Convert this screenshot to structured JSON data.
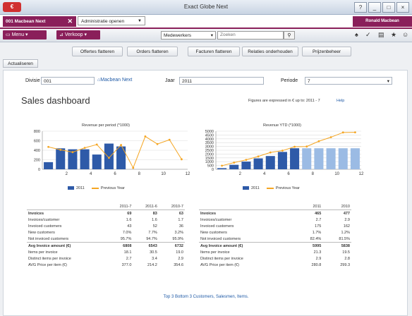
{
  "window": {
    "title": "Exact Globe Next",
    "app_button": "€",
    "controls": [
      "?",
      "_",
      "□",
      "×"
    ]
  },
  "tabs": {
    "active": "001 Macbean Next",
    "close": "✕",
    "second": "Administratie openen",
    "user": "Ronald Macbean"
  },
  "menubar": {
    "menu": "Menu",
    "sales": "Verkoop",
    "category": "Medewerkers",
    "search_placeholder": "Zoeken",
    "search_btn": "⚲",
    "icons": [
      "pin-icon",
      "check-icon",
      "document-icon",
      "star-icon",
      "people-icon"
    ]
  },
  "toolbar": {
    "buttons": [
      "Offertes flatteren",
      "Orders flatteren",
      "Facturen flatteren",
      "Relaties onderhouden",
      "Prijzenbeheer"
    ],
    "refresh": "Actualiseren"
  },
  "filters": {
    "division_label": "Divisie",
    "division_value": "001",
    "division_link": "Macbean Next",
    "year_label": "Jaar",
    "year_value": "2011",
    "period_label": "Periode",
    "period_value": "7"
  },
  "dashboard": {
    "title": "Sales dashboard",
    "note": "Figures are expressed in € up to: 2011 - 7",
    "help": "Help",
    "footer": "Top 3 Bottom 3 Customers, Salesmen, Items."
  },
  "colors": {
    "accent": "#8a1f5a",
    "bar_2011": "#2e5aa8",
    "bar_projected": "#9bbbe4",
    "line_prev": "#f5a623"
  },
  "chart_data": [
    {
      "type": "bar",
      "title": "Revenue per period (*1000)",
      "x": [
        1,
        2,
        3,
        4,
        5,
        6,
        7,
        8,
        9,
        10,
        11,
        12
      ],
      "xticks": [
        2,
        4,
        6,
        8,
        10,
        12
      ],
      "ylim": [
        0,
        800
      ],
      "yticks": [
        0,
        200,
        400,
        600,
        800
      ],
      "series": [
        {
          "name": "2011",
          "kind": "bar",
          "values": [
            150,
            440,
            420,
            420,
            310,
            540,
            480,
            null,
            null,
            null,
            null,
            null
          ]
        },
        {
          "name": "Previous Year",
          "kind": "line",
          "values": [
            470,
            410,
            360,
            450,
            520,
            240,
            510,
            30,
            690,
            530,
            620,
            210
          ]
        }
      ],
      "legend": "bottom"
    },
    {
      "type": "bar",
      "title": "Revenue YTD (*1000)",
      "x": [
        1,
        2,
        3,
        4,
        5,
        6,
        7,
        8,
        9,
        10,
        11,
        12
      ],
      "xticks": [
        2,
        4,
        6,
        8,
        10,
        12
      ],
      "ylim": [
        0,
        5000
      ],
      "yticks": [
        0,
        500,
        1000,
        1500,
        2000,
        2500,
        3000,
        3500,
        4000,
        4500,
        5000
      ],
      "series": [
        {
          "name": "2011",
          "kind": "bar",
          "values": [
            150,
            590,
            1010,
            1430,
            1740,
            2280,
            2760,
            2760,
            2760,
            2760,
            2760,
            2760
          ]
        },
        {
          "name": "Previous Year",
          "kind": "line",
          "values": [
            470,
            880,
            1240,
            1690,
            2210,
            2450,
            2960,
            2990,
            3680,
            4210,
            4830,
            4850
          ]
        }
      ],
      "legend": "bottom"
    }
  ],
  "table_left": {
    "headers": [
      "2011-7",
      "2011-6",
      "2010-7"
    ],
    "rows": [
      {
        "label": "Invoices",
        "bold": true,
        "values": [
          "69",
          "83",
          "63"
        ]
      },
      {
        "label": "Invoices/customer",
        "values": [
          "1.6",
          "1.6",
          "1.7"
        ]
      },
      {
        "label": "Invoiced customers",
        "values": [
          "43",
          "52",
          "36"
        ]
      },
      {
        "label": "New customers",
        "values": [
          "7.0%",
          "7.7%",
          "3.2%"
        ]
      },
      {
        "label": "Not invoiced customers",
        "values": [
          "95.7%",
          "94.7%",
          "95.9%"
        ]
      },
      {
        "label": "Avg Invoice amount (€)",
        "bold": true,
        "section": true,
        "values": [
          "6808",
          "6543",
          "6732"
        ]
      },
      {
        "label": "Items per invoice",
        "values": [
          "18.1",
          "30.5",
          "19.0"
        ]
      },
      {
        "label": "Distinct items per invoice",
        "values": [
          "2.7",
          "3.4",
          "2.9"
        ]
      },
      {
        "label": "AVG Price per item (€)",
        "values": [
          "377.0",
          "214.2",
          "354.6"
        ]
      }
    ]
  },
  "table_right": {
    "headers": [
      "2011",
      "2010"
    ],
    "rows": [
      {
        "label": "Invoices",
        "bold": true,
        "values": [
          "465",
          "477"
        ]
      },
      {
        "label": "Invoices/customer",
        "values": [
          "2.7",
          "2.9"
        ]
      },
      {
        "label": "Invoiced customers",
        "values": [
          "175",
          "162"
        ]
      },
      {
        "label": "New customers",
        "values": [
          "1.7%",
          "1.2%"
        ]
      },
      {
        "label": "Not invoiced customers",
        "values": [
          "82.4%",
          "81.5%"
        ]
      },
      {
        "label": "Avg Invoice amount (€)",
        "bold": true,
        "section": true,
        "values": [
          "5995",
          "5838"
        ]
      },
      {
        "label": "Items per invoice",
        "values": [
          "21.3",
          "19.5"
        ]
      },
      {
        "label": "Distinct items per invoice",
        "values": [
          "2.9",
          "2.8"
        ]
      },
      {
        "label": "AVG Price per item (€)",
        "values": [
          "280.8",
          "299.3"
        ]
      }
    ]
  }
}
